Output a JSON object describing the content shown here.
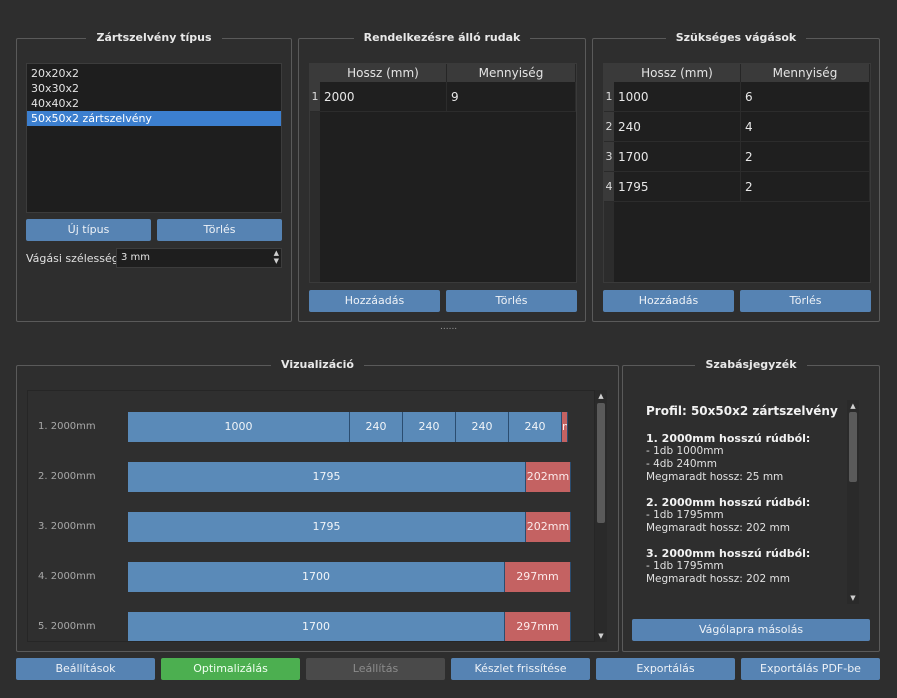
{
  "profile_type": {
    "title": "Zártszelvény típus",
    "items": [
      "20x20x2",
      "30x30x2",
      "40x40x2",
      "50x50x2 zártszelvény"
    ],
    "selected_index": 3,
    "new_button": "Új típus",
    "delete_button": "Törlés",
    "kerf_label": "Vágási szélesség:",
    "kerf_value": "3 mm"
  },
  "stock": {
    "title": "Rendelkezésre álló rudak",
    "columns": [
      "Hossz (mm)",
      "Mennyiség"
    ],
    "rows": [
      [
        "1",
        "2000",
        "9"
      ]
    ],
    "add_button": "Hozzáadás",
    "delete_button": "Törlés"
  },
  "cuts": {
    "title": "Szükséges vágások",
    "columns": [
      "Hossz (mm)",
      "Mennyiség"
    ],
    "rows": [
      [
        "1",
        "1000",
        "6"
      ],
      [
        "2",
        "240",
        "4"
      ],
      [
        "3",
        "1700",
        "2"
      ],
      [
        "4",
        "1795",
        "2"
      ]
    ],
    "add_button": "Hozzáadás",
    "delete_button": "Törlés"
  },
  "splitter_handle": "......",
  "visualization": {
    "title": "Vizualizáció",
    "bars": [
      {
        "label": "1. 2000mm",
        "segments": [
          {
            "text": "1000",
            "value": 1000,
            "kind": "piece"
          },
          {
            "text": "240",
            "value": 240,
            "kind": "piece"
          },
          {
            "text": "240",
            "value": 240,
            "kind": "piece"
          },
          {
            "text": "240",
            "value": 240,
            "kind": "piece"
          },
          {
            "text": "240",
            "value": 240,
            "kind": "piece"
          },
          {
            "text": "m",
            "value": 25,
            "kind": "waste"
          }
        ]
      },
      {
        "label": "2. 2000mm",
        "segments": [
          {
            "text": "1795",
            "value": 1795,
            "kind": "piece"
          },
          {
            "text": "202mm",
            "value": 202,
            "kind": "waste"
          }
        ]
      },
      {
        "label": "3. 2000mm",
        "segments": [
          {
            "text": "1795",
            "value": 1795,
            "kind": "piece"
          },
          {
            "text": "202mm",
            "value": 202,
            "kind": "waste"
          }
        ]
      },
      {
        "label": "4. 2000mm",
        "segments": [
          {
            "text": "1700",
            "value": 1700,
            "kind": "piece"
          },
          {
            "text": "297mm",
            "value": 297,
            "kind": "waste"
          }
        ]
      },
      {
        "label": "5. 2000mm",
        "segments": [
          {
            "text": "1700",
            "value": 1700,
            "kind": "piece"
          },
          {
            "text": "297mm",
            "value": 297,
            "kind": "waste"
          }
        ]
      }
    ],
    "bar_total": 2000
  },
  "cutlist": {
    "title": "Szabásjegyzék",
    "profile_line": "Profil: 50x50x2 zártszelvény",
    "sections": [
      {
        "heading": "1. 2000mm hosszú rúdból:",
        "lines": [
          "- 1db 1000mm",
          "- 4db 240mm",
          "Megmaradt hossz: 25 mm"
        ]
      },
      {
        "heading": "2. 2000mm hosszú rúdból:",
        "lines": [
          "- 1db 1795mm",
          "Megmaradt hossz: 202 mm"
        ]
      },
      {
        "heading": "3. 2000mm hosszú rúdból:",
        "lines": [
          "- 1db 1795mm",
          "Megmaradt hossz: 202 mm"
        ]
      }
    ],
    "copy_button": "Vágólapra másolás"
  },
  "bottom_buttons": {
    "settings": "Beállítások",
    "optimize": "Optimalizálás",
    "stop": "Leállítás",
    "refresh": "Készlet frissítése",
    "export": "Exportálás",
    "export_pdf": "Exportálás PDF-be"
  },
  "colors": {
    "accent": "#5683b3",
    "piece": "#5a8ab8",
    "waste": "#c46262",
    "optimize": "#4caf50",
    "selection": "#3c7fcf"
  }
}
